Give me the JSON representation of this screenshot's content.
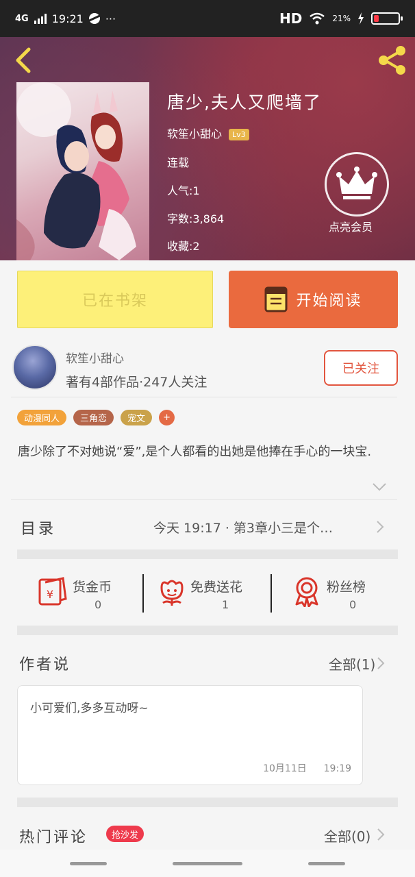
{
  "status_bar": {
    "network": "4G",
    "time": "19:21",
    "more": "···",
    "hd": "HD",
    "battery_percent": "21%",
    "battery_level": 0.21
  },
  "hero": {
    "title": "唐少,夫人又爬墙了",
    "author": "软笙小甜心",
    "level": "Lv3",
    "status": "连载",
    "popularity": "人气:1",
    "word_count": "字数:3,864",
    "favorites": "收藏:2",
    "vip_label": "点亮会员"
  },
  "actions": {
    "shelf_label": "已在书架",
    "read_label": "开始阅读"
  },
  "author": {
    "name": "软笙小甜心",
    "stats": "著有4部作品·247人关注",
    "follow_label": "已关注"
  },
  "tags": [
    {
      "label": "动漫同人",
      "color": "#f2a23a"
    },
    {
      "label": "三角恋",
      "color": "#b5654a"
    },
    {
      "label": "宠文",
      "color": "#caa24a"
    },
    {
      "label": "+",
      "color": "#e46a45"
    }
  ],
  "synopsis": "唐少除了不对她说“爱”,是个人都看的出她是他捧在手心的一块宝.",
  "toc": {
    "label": "目录",
    "latest": "今天 19:17 · 第3章小三是个…"
  },
  "stats": [
    {
      "label": "货金币",
      "value": "0",
      "icon": "red-envelope-icon"
    },
    {
      "label": "免费送花",
      "value": "1",
      "icon": "flower-icon"
    },
    {
      "label": "粉丝榜",
      "value": "0",
      "icon": "medal-icon"
    }
  ],
  "author_says": {
    "title": "作者说",
    "all_label": "全部(1)",
    "message": "小可爱们,多多互动呀~",
    "date": "10月11日",
    "time": "19:19"
  },
  "hot_comments": {
    "title": "热门评论",
    "badge": "抢沙发",
    "all_label": "全部(0)"
  },
  "colors": {
    "accent_orange": "#ea6a3e",
    "shelf_yellow": "#fdf079",
    "follow_red": "#e2553e",
    "badge_red": "#ee3a4c",
    "icon_red": "#d9352a",
    "back_yellow": "#f4d84a"
  }
}
